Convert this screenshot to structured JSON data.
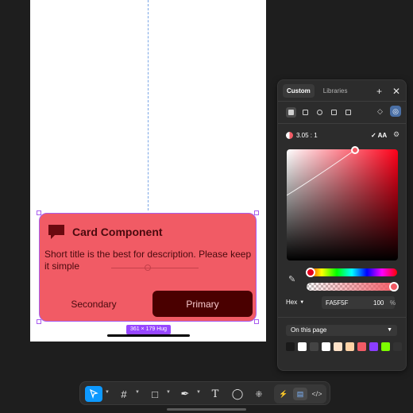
{
  "card": {
    "title": "Card Component",
    "description": "Short title is the best for description. Please keep it simple",
    "secondary_label": "Secondary",
    "primary_label": "Primary",
    "size_badge": "361 × 179 Hug"
  },
  "picker": {
    "tabs": [
      "Custom",
      "Libraries"
    ],
    "contrast": "3.05 : 1",
    "aa_label": "AA",
    "format": "Hex",
    "hex": "FA5F5F",
    "opacity": "100",
    "opacity_unit": "%",
    "library_source": "On this page",
    "swatch_colors": [
      "#1a1a1a",
      "#ffffff",
      "#444444",
      "#ffffff",
      "#fde2c8",
      "#ffd3a6",
      "#f15b65",
      "#8b3dff",
      "#7cfc00",
      "#333333"
    ]
  },
  "colors": {
    "card_fill": "#f15b65",
    "selection": "#9747ff",
    "primary_button": "#4a0000",
    "accent": "#0d99ff"
  },
  "toolbar": {
    "tools": [
      "move-icon",
      "frame-icon",
      "shape-icon",
      "pen-icon",
      "text-icon",
      "comment-icon",
      "components-icon"
    ],
    "modes": [
      "design-mode-icon",
      "prototype-mode-icon",
      "dev-mode-icon"
    ]
  }
}
